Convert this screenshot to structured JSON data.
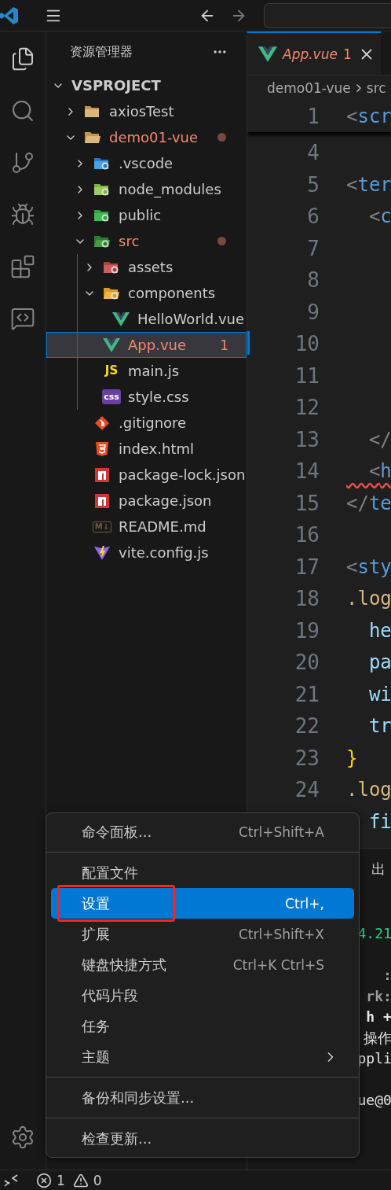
{
  "explorer": {
    "title": "资源管理器",
    "project": {
      "name": "VSPROJECT",
      "expanded": true
    },
    "tree": [
      {
        "name": "axiosTest",
        "kind": "folder",
        "expanded": false,
        "problem": false,
        "selected": false
      },
      {
        "name": "demo01-vue",
        "kind": "folder",
        "expanded": true,
        "problem": true,
        "selected": false,
        "children": [
          {
            "name": ".vscode",
            "kind": "vscode",
            "expanded": false,
            "problem": false,
            "selected": false
          },
          {
            "name": "node_modules",
            "kind": "node",
            "expanded": false,
            "problem": false,
            "selected": false
          },
          {
            "name": "public",
            "kind": "public",
            "expanded": false,
            "problem": false,
            "selected": false
          },
          {
            "name": "src",
            "kind": "src",
            "expanded": true,
            "problem": true,
            "selected": false,
            "children": [
              {
                "name": "assets",
                "kind": "assets",
                "expanded": false,
                "problem": false,
                "selected": false
              },
              {
                "name": "components",
                "kind": "components",
                "expanded": true,
                "problem": false,
                "selected": false,
                "children": [
                  {
                    "name": "HelloWorld.vue",
                    "kind": "vue",
                    "problem": false,
                    "selected": false
                  }
                ]
              },
              {
                "name": "App.vue",
                "kind": "vue",
                "problem": true,
                "selected": true,
                "badge": "1"
              },
              {
                "name": "main.js",
                "kind": "js",
                "glyph": "JS",
                "problem": false,
                "selected": false
              },
              {
                "name": "style.css",
                "kind": "css",
                "glyph": "css",
                "problem": false,
                "selected": false
              }
            ]
          },
          {
            "name": ".gitignore",
            "kind": "git",
            "problem": false,
            "selected": false
          },
          {
            "name": "index.html",
            "kind": "html",
            "problem": false,
            "selected": false
          },
          {
            "name": "package-lock.json",
            "kind": "npm",
            "problem": false,
            "selected": false
          },
          {
            "name": "package.json",
            "kind": "npm",
            "problem": false,
            "selected": false
          },
          {
            "name": "README.md",
            "kind": "markdown",
            "glyph": "M↓",
            "problem": false,
            "selected": false
          },
          {
            "name": "vite.config.js",
            "kind": "vite",
            "problem": false,
            "selected": false
          }
        ]
      }
    ]
  },
  "editor": {
    "tabs": [
      {
        "label": "App.vue",
        "badge": "1",
        "problem": true,
        "selected": true
      }
    ],
    "breadcrumb": [
      "demo01-vue",
      "src"
    ],
    "lines": [
      {
        "number": "1",
        "sticky": true,
        "tokens": [
          {
            "kind": "punct",
            "text": "<"
          },
          {
            "kind": "tag",
            "text": "scr"
          }
        ]
      },
      {
        "number": "4"
      },
      {
        "number": "5",
        "tokens": [
          {
            "kind": "punct",
            "text": "<"
          },
          {
            "kind": "tag",
            "text": "ter"
          }
        ]
      },
      {
        "number": "6",
        "tokens": [
          {
            "kind": "punct",
            "text": "  <"
          },
          {
            "kind": "tag",
            "text": "c"
          }
        ]
      },
      {
        "number": "7"
      },
      {
        "number": "8"
      },
      {
        "number": "9"
      },
      {
        "number": "10",
        "current": true
      },
      {
        "number": "11"
      },
      {
        "number": "12"
      },
      {
        "number": "13",
        "tokens": [
          {
            "kind": "punct",
            "text": "  </"
          }
        ]
      },
      {
        "number": "14",
        "error": true,
        "tokens": [
          {
            "kind": "punct",
            "text": "  <"
          },
          {
            "kind": "tag",
            "text": "h"
          }
        ]
      },
      {
        "number": "15",
        "tokens": [
          {
            "kind": "punct",
            "text": "</"
          },
          {
            "kind": "tag",
            "text": "te"
          }
        ]
      },
      {
        "number": "16"
      },
      {
        "number": "17",
        "tokens": [
          {
            "kind": "punct",
            "text": "<"
          },
          {
            "kind": "tag",
            "text": "sty"
          }
        ]
      },
      {
        "number": "18",
        "tokens": [
          {
            "kind": "selector",
            "text": ".log"
          }
        ]
      },
      {
        "number": "19",
        "tokens": [
          {
            "kind": "prop",
            "text": "  he"
          }
        ]
      },
      {
        "number": "20",
        "tokens": [
          {
            "kind": "prop",
            "text": "  pa"
          }
        ]
      },
      {
        "number": "21",
        "tokens": [
          {
            "kind": "prop",
            "text": "  wi"
          }
        ]
      },
      {
        "number": "22",
        "tokens": [
          {
            "kind": "prop",
            "text": "  tr"
          }
        ]
      },
      {
        "number": "23",
        "tokens": [
          {
            "kind": "brace",
            "text": "}"
          }
        ]
      },
      {
        "number": "24",
        "tokens": [
          {
            "kind": "selector",
            "text": ".log"
          }
        ]
      },
      {
        "tokens": [
          {
            "kind": "prop",
            "text": "  fi"
          }
        ]
      }
    ]
  },
  "panel": {
    "tab": "出",
    "lines": [
      {
        "kind": "blank"
      },
      {
        "kind": "blank"
      },
      {
        "kind": "green",
        "text": "4.21"
      },
      {
        "kind": "blank"
      },
      {
        "kind": "dim",
        "text": ":"
      },
      {
        "kind": "dim",
        "text": "rk:"
      },
      {
        "kind": "bold",
        "text": "h +"
      },
      {
        "kind": "plain",
        "text": "操作"
      },
      {
        "kind": "plain",
        "text": "ppli"
      },
      {
        "kind": "blank"
      },
      {
        "kind": "plain",
        "text": "ue@0"
      }
    ]
  },
  "menu": {
    "groups": [
      [
        {
          "label": "命令面板...",
          "shortcut": "Ctrl+Shift+A",
          "selected": false
        }
      ],
      [
        {
          "label": "配置文件",
          "selected": false
        },
        {
          "label": "设置",
          "shortcut": "Ctrl+,",
          "selected": true,
          "outlined": true
        },
        {
          "label": "扩展",
          "shortcut": "Ctrl+Shift+X",
          "selected": false
        },
        {
          "label": "键盘快捷方式",
          "shortcut": "Ctrl+K Ctrl+S",
          "selected": false
        },
        {
          "label": "代码片段",
          "selected": false
        },
        {
          "label": "任务",
          "selected": false
        },
        {
          "label": "主题",
          "submenu": true,
          "selected": false
        }
      ],
      [
        {
          "label": "备份和同步设置...",
          "selected": false
        }
      ],
      [
        {
          "label": "检查更新...",
          "selected": false
        }
      ]
    ]
  },
  "status_bar": {
    "errors": "1",
    "warnings": "0"
  }
}
